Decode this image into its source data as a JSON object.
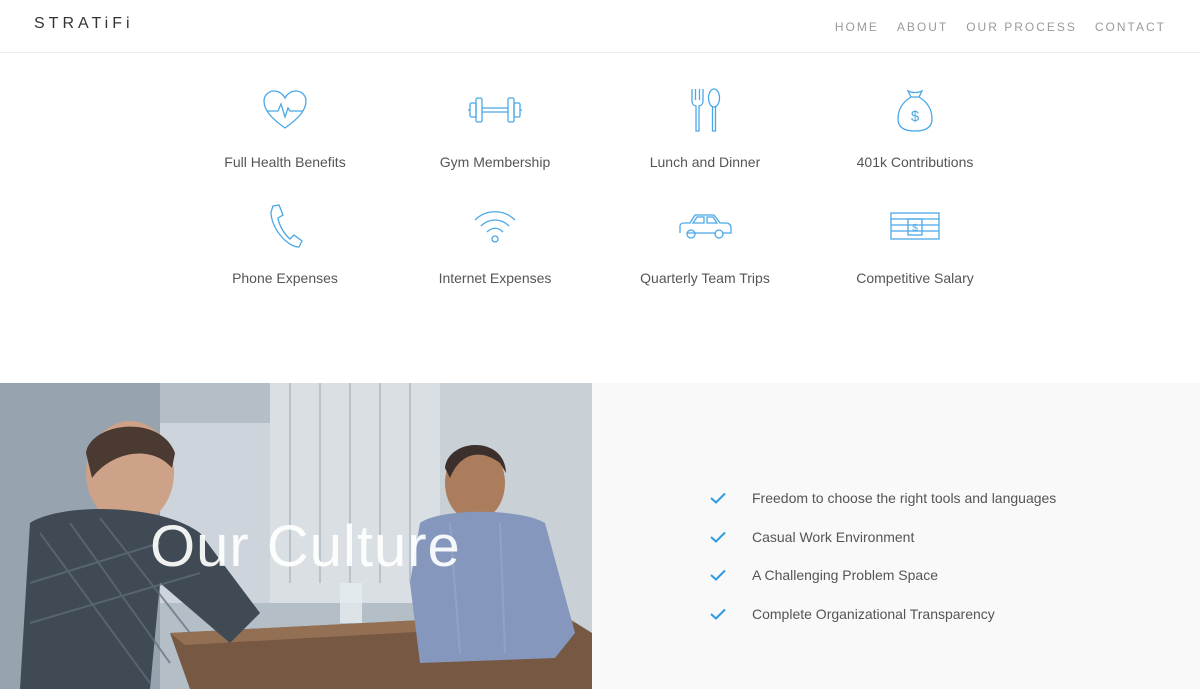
{
  "header": {
    "logo": "STRATiFi",
    "nav": [
      "HOME",
      "ABOUT",
      "OUR PROCESS",
      "CONTACT"
    ]
  },
  "benefits": [
    {
      "label": "Full Health Benefits",
      "icon": "heart-pulse-icon"
    },
    {
      "label": "Gym Membership",
      "icon": "dumbbell-icon"
    },
    {
      "label": "Lunch and Dinner",
      "icon": "fork-spoon-icon"
    },
    {
      "label": "401k Contributions",
      "icon": "money-bag-icon"
    },
    {
      "label": "Phone Expenses",
      "icon": "phone-icon"
    },
    {
      "label": "Internet Expenses",
      "icon": "wifi-icon"
    },
    {
      "label": "Quarterly Team Trips",
      "icon": "car-icon"
    },
    {
      "label": "Competitive Salary",
      "icon": "cash-stack-icon"
    }
  ],
  "culture": {
    "title": "Our Culture",
    "items": [
      "Freedom to choose the right tools and languages",
      "Casual Work Environment",
      "A Challenging Problem Space",
      "Complete Organizational Transparency"
    ]
  },
  "colors": {
    "accent": "#4aa8e8",
    "check": "#2d9be0",
    "nav_text": "#9a9a9a",
    "panel_bg": "#f9f9f9"
  }
}
